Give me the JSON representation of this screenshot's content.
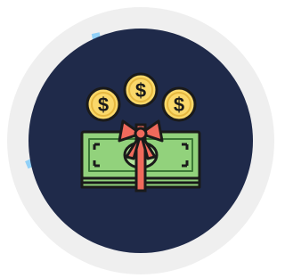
{
  "badge": {
    "icon": "money-gift-icon",
    "progress_percent": 22,
    "colors": {
      "outer_ring": "#efefef",
      "inner_disc": "#1f2a4a",
      "progress_arc": "#91d0f7",
      "coin_fill": "#fad86a",
      "coin_stroke": "#1a1a1a",
      "bill_fill": "#92d27c",
      "bill_dark": "#3d7a37",
      "ribbon": "#f06a5c"
    }
  },
  "coins": [
    {
      "symbol": "$"
    },
    {
      "symbol": "$"
    },
    {
      "symbol": "$"
    }
  ]
}
